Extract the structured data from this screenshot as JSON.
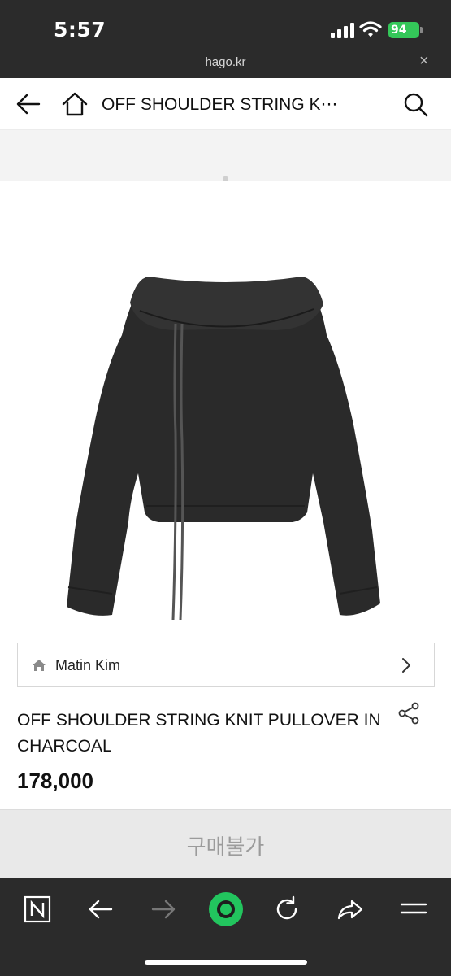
{
  "status": {
    "time": "5:57",
    "battery": "94"
  },
  "browser": {
    "url": "hago.kr",
    "close_label": "×"
  },
  "nav": {
    "title": "OFF SHOULDER STRING K⋯"
  },
  "brand": {
    "name": "Matin Kim"
  },
  "product": {
    "title": "OFF SHOULDER STRING KNIT PULLOVER IN CHARCOAL",
    "price": "178,000",
    "image_alt": "charcoal off-shoulder knit pullover with string ties"
  },
  "purchase": {
    "label": "구매불가"
  },
  "icons": {
    "back": "arrow-left-icon",
    "home": "house-icon",
    "search": "search-icon",
    "share": "share-nodes-icon",
    "chevron": "chevron-right-icon"
  },
  "colors": {
    "status_bg": "#2b2b2b",
    "battery": "#34c759",
    "accent_green": "#22c55e",
    "button_disabled_bg": "#e9e9e9"
  }
}
